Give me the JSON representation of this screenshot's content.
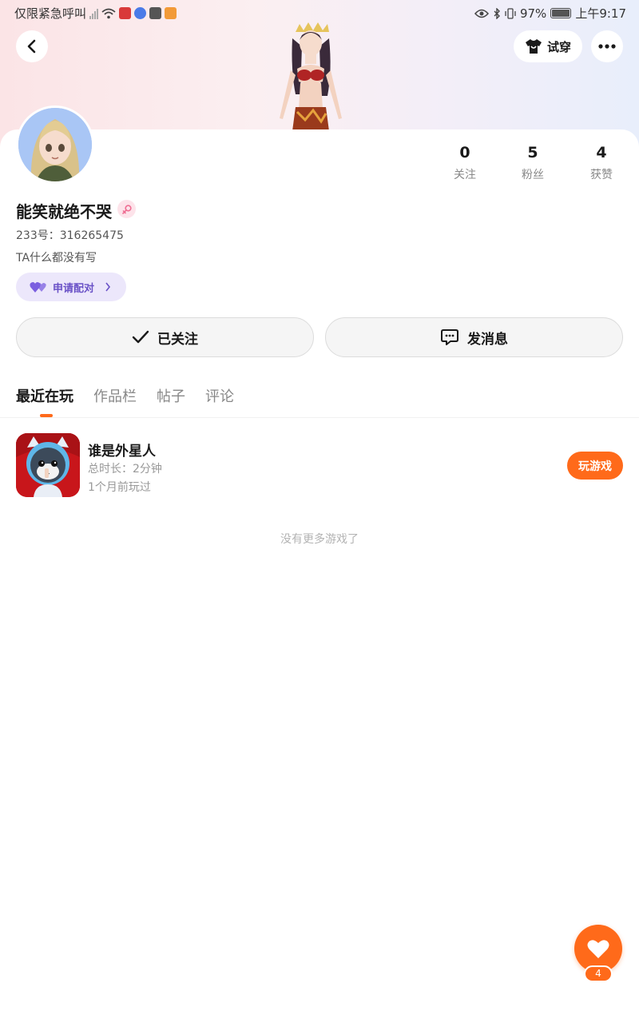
{
  "status_bar": {
    "carrier": "仅限紧急呼叫",
    "battery": "97%",
    "time": "上午9:17",
    "app_colors": [
      "#d93a3a",
      "#4a7be8",
      "#555555",
      "#f29a38"
    ]
  },
  "header": {
    "back_icon": "chevron-left-icon",
    "tryon_label": "试穿",
    "tryon_icon": "shirt-icon",
    "more_icon": "more-dots-icon"
  },
  "profile": {
    "username": "能笑就绝不哭",
    "uid_line": "233号：316265475",
    "bio": "TA什么都没有写",
    "pair_label": "申请配对",
    "gender_icon": "female-icon"
  },
  "stats": [
    {
      "value": "0",
      "label": "关注"
    },
    {
      "value": "5",
      "label": "粉丝"
    },
    {
      "value": "4",
      "label": "获赞"
    }
  ],
  "actions": {
    "follow_label": "已关注",
    "message_label": "发消息"
  },
  "tabs": [
    {
      "label": "最近在玩",
      "active": true
    },
    {
      "label": "作品栏",
      "active": false
    },
    {
      "label": "帖子",
      "active": false
    },
    {
      "label": "评论",
      "active": false
    }
  ],
  "games": [
    {
      "title": "谁是外星人",
      "duration": "总时长：2分钟",
      "last_played": "1个月前玩过",
      "play_label": "玩游戏"
    }
  ],
  "no_more_text": "没有更多游戏了",
  "fab": {
    "count": "4",
    "icon": "heart-icon"
  },
  "colors": {
    "accent": "#ff6a1a",
    "pair_text": "#6a52c7",
    "pair_bg": "#ece7fb"
  }
}
